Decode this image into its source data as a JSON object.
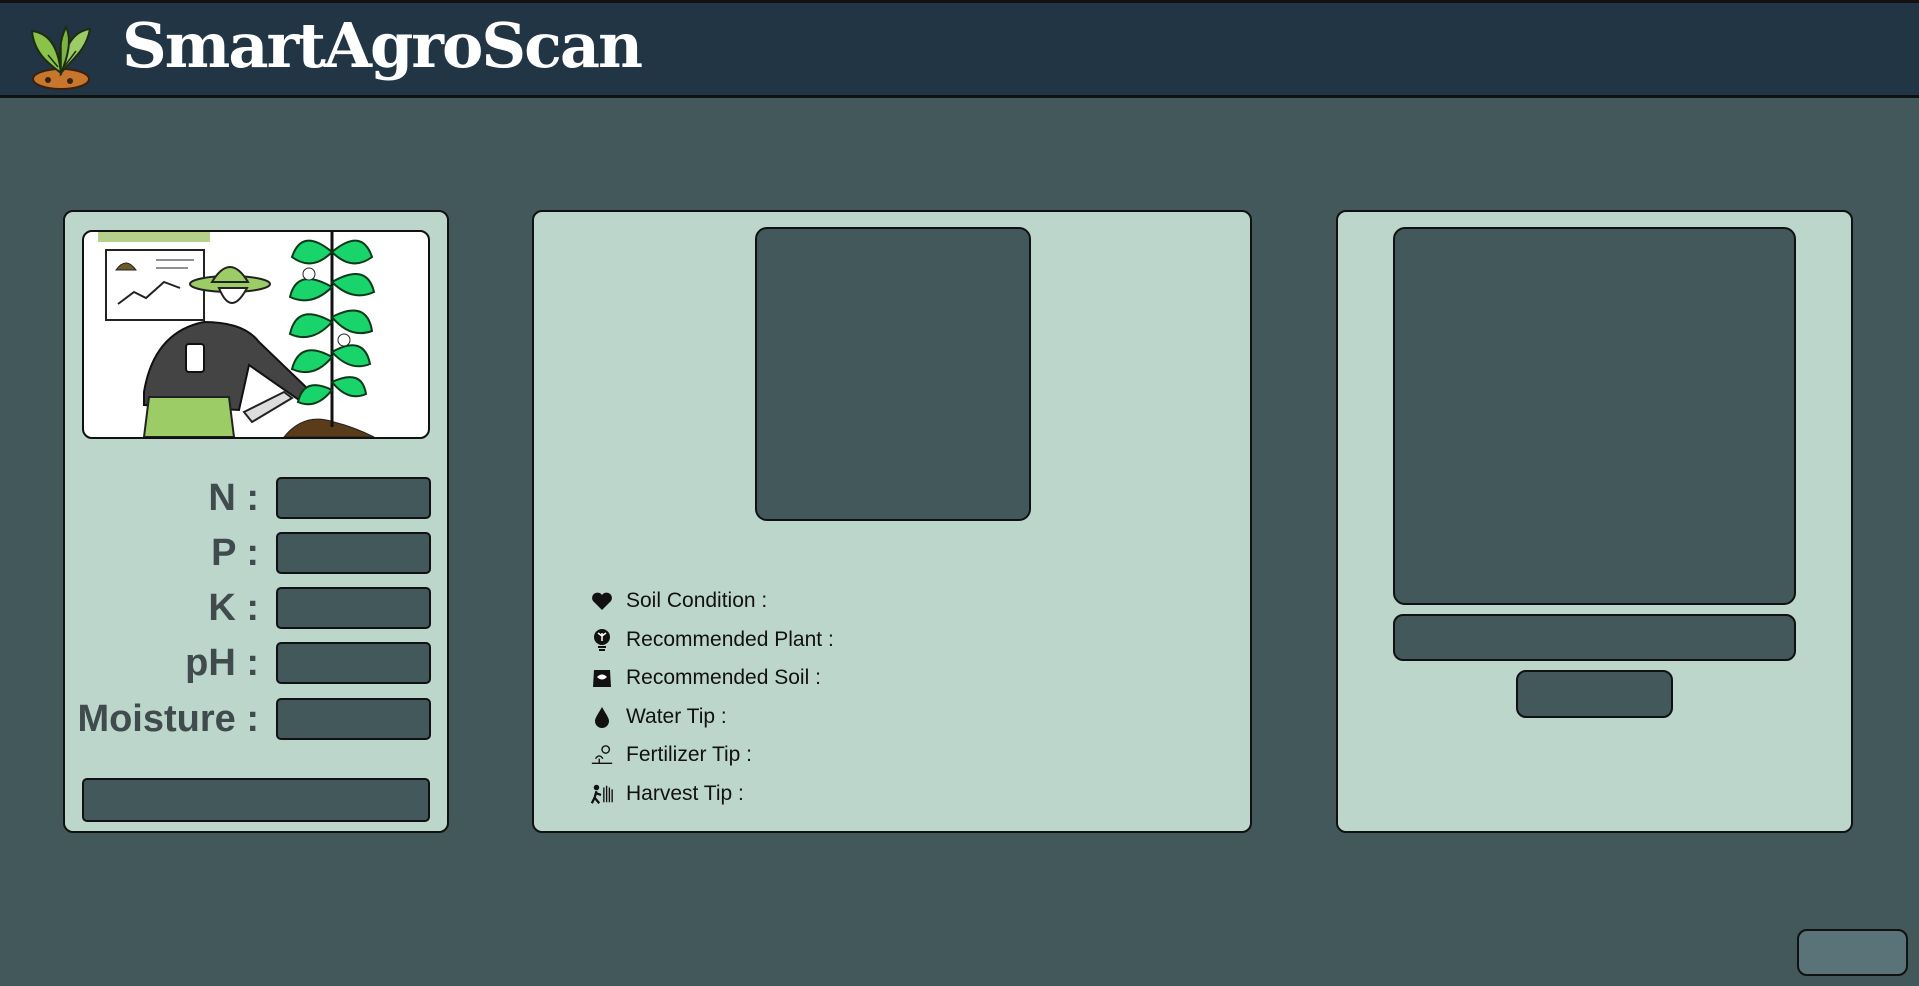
{
  "app": {
    "title": "SmartAgroScan",
    "logo_icon": "sprout-leaf-logo"
  },
  "colors": {
    "page_bg": "#42585a",
    "header_bg": "#223545",
    "panel_bg": "#bcd6cc",
    "field_bg": "#42585a",
    "label_text": "#3f4b4c"
  },
  "sensor_panel": {
    "illustration": "farmer-planting-illustration",
    "fields": [
      {
        "label": "N :",
        "value": ""
      },
      {
        "label": "P :",
        "value": ""
      },
      {
        "label": "K :",
        "value": ""
      },
      {
        "label": "pH :",
        "value": ""
      },
      {
        "label": "Moisture :",
        "value": ""
      }
    ],
    "submit_label": ""
  },
  "results_panel": {
    "items": [
      {
        "icon": "heart-icon",
        "label": "Soil Condition :"
      },
      {
        "icon": "plant-bulb-icon",
        "label": "Recommended Plant :"
      },
      {
        "icon": "soil-bag-icon",
        "label": "Recommended Soil :"
      },
      {
        "icon": "water-drop-icon",
        "label": "Water Tip :"
      },
      {
        "icon": "fertilizer-icon",
        "label": "Fertilizer Tip :"
      },
      {
        "icon": "harvest-icon",
        "label": "Harvest Tip :"
      }
    ]
  },
  "upload_panel": {
    "file_name": "",
    "scan_label": ""
  },
  "corner_button_label": ""
}
